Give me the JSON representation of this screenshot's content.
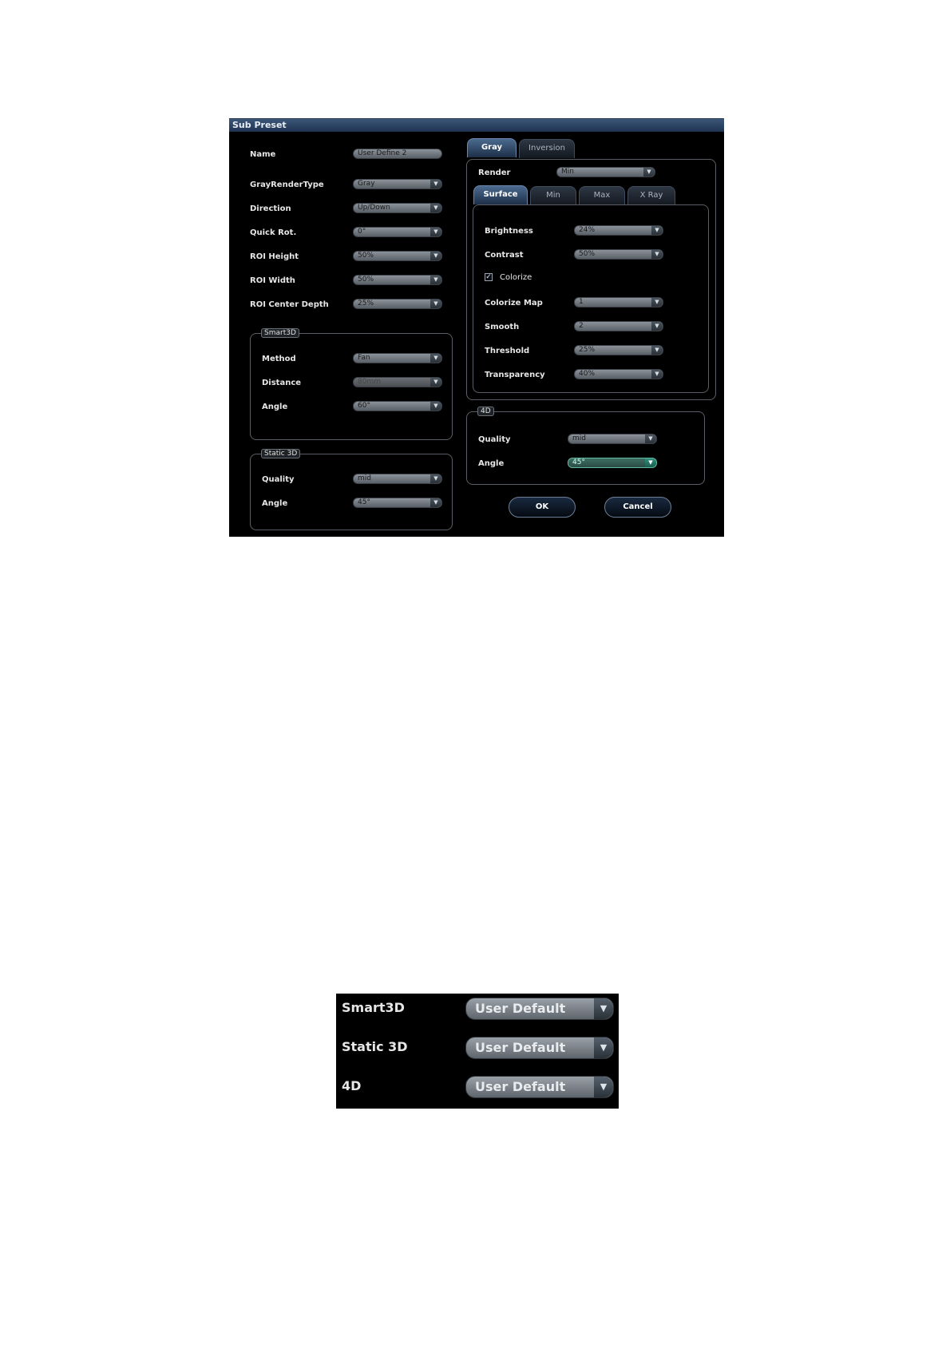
{
  "dialog": {
    "title": "Sub Preset",
    "name_label": "Name",
    "name_value": "User Define 2",
    "left_fields": [
      {
        "label": "GrayRenderType",
        "value": "Gray"
      },
      {
        "label": "Direction",
        "value": "Up/Down"
      },
      {
        "label": "Quick Rot.",
        "value": "0°"
      },
      {
        "label": "ROI Height",
        "value": "50%"
      },
      {
        "label": "ROI Width",
        "value": "50%"
      },
      {
        "label": "ROI Center Depth",
        "value": "25%"
      }
    ],
    "smart3d": {
      "legend": "Smart3D",
      "method_label": "Method",
      "method_value": "Fan",
      "distance_label": "Distance",
      "distance_value": "80mm",
      "angle_label": "Angle",
      "angle_value": "60°"
    },
    "static3d": {
      "legend": "Static 3D",
      "quality_label": "Quality",
      "quality_value": "mid",
      "angle_label": "Angle",
      "angle_value": "45°"
    },
    "tabs": {
      "gray": "Gray",
      "inversion": "Inversion"
    },
    "render_label": "Render",
    "render_value": "Min",
    "subtabs": {
      "surface": "Surface",
      "min": "Min",
      "max": "Max",
      "xray": "X Ray"
    },
    "surface": {
      "brightness_label": "Brightness",
      "brightness_value": "24%",
      "contrast_label": "Contrast",
      "contrast_value": "50%",
      "colorize_label": "Colorize",
      "colorize_checked": "✓",
      "colorize_map_label": "Colorize Map",
      "colorize_map_value": "1",
      "smooth_label": "Smooth",
      "smooth_value": "2",
      "threshold_label": "Threshold",
      "threshold_value": "25%",
      "transparency_label": "Transparency",
      "transparency_value": "40%"
    },
    "fourd": {
      "legend": "4D",
      "quality_label": "Quality",
      "quality_value": "mid",
      "angle_label": "Angle",
      "angle_value": "45°"
    },
    "ok_label": "OK",
    "cancel_label": "Cancel",
    "arrow_glyph": "▼"
  },
  "panel2": {
    "rows": [
      {
        "label": "Smart3D",
        "value": "User Default"
      },
      {
        "label": "Static 3D",
        "value": "User Default"
      },
      {
        "label": "4D",
        "value": "User Default"
      }
    ]
  }
}
